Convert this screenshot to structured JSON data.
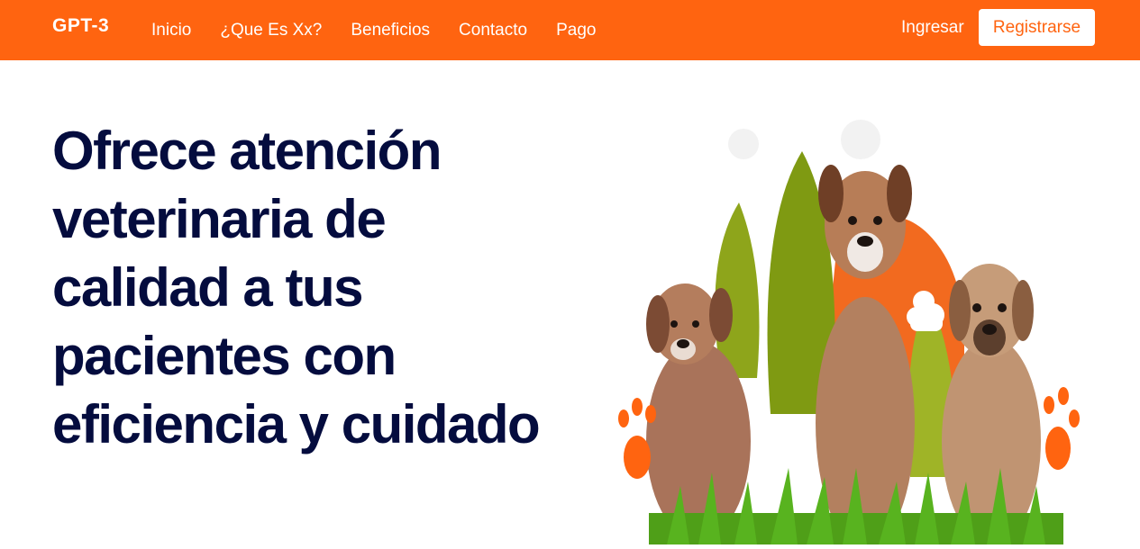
{
  "nav": {
    "logo": "GPT-3",
    "links": [
      "Inicio",
      "¿Que Es Xx?",
      "Beneficios",
      "Contacto",
      "Pago"
    ],
    "login_label": "Ingresar",
    "register_label": "Registrarse"
  },
  "hero": {
    "title": "Ofrece atención veterinaria de calidad a tus pacientes con eficiencia y cuidado"
  },
  "colors": {
    "accent": "#ff6410",
    "heading": "#040c3e",
    "background": "#ffffff"
  },
  "icons": [
    "paw-icon",
    "dog-illustration",
    "leaf-icon",
    "grass",
    "cloud-icon"
  ]
}
